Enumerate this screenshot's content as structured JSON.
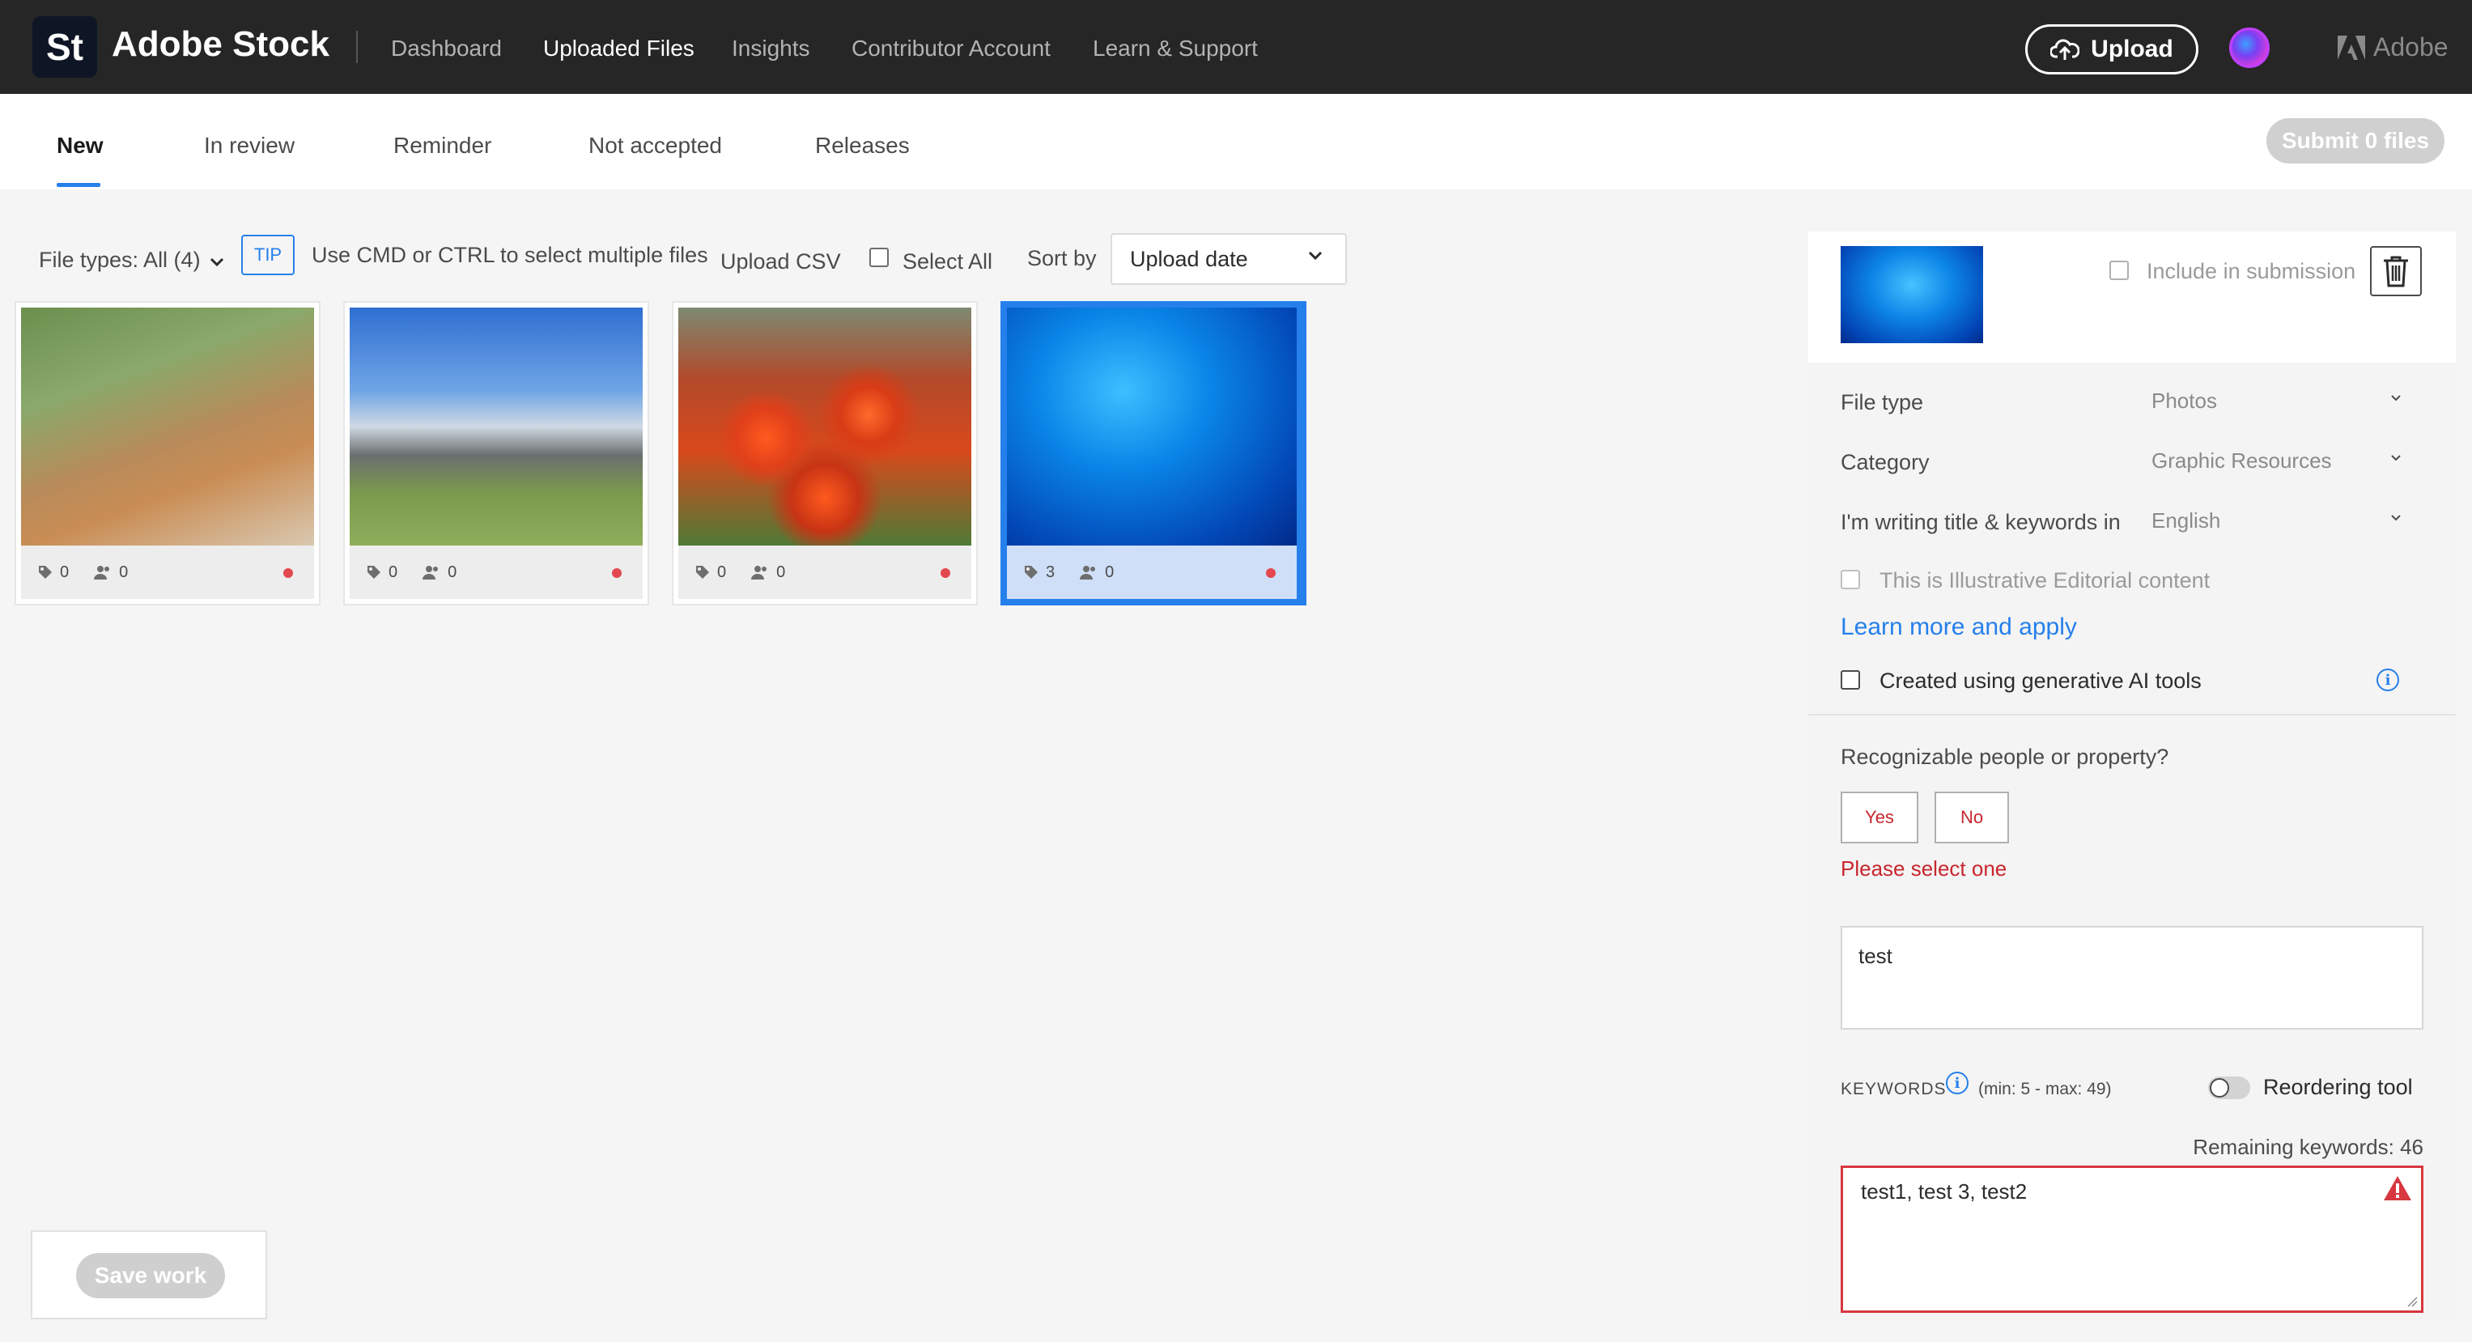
{
  "app": {
    "logo_text": "St",
    "brand": "Adobe Stock",
    "vendor": "Adobe"
  },
  "topnav": [
    "Dashboard",
    "Uploaded Files",
    "Insights",
    "Contributor Account",
    "Learn & Support"
  ],
  "topnav_active": "Uploaded Files",
  "upload_label": "Upload",
  "tabs": [
    "New",
    "In review",
    "Reminder",
    "Not accepted",
    "Releases"
  ],
  "tabs_active": "New",
  "submit_label": "Submit 0 files",
  "filter": {
    "file_types": "File types: All (4)",
    "tip": "TIP",
    "tip_text": "Use CMD or CTRL to select multiple files",
    "upload_csv": "Upload CSV",
    "select_all": "Select All",
    "sort_by": "Sort by",
    "sort_value": "Upload date"
  },
  "thumbnails": [
    {
      "keywords": "0",
      "releases": "0",
      "selected": false
    },
    {
      "keywords": "0",
      "releases": "0",
      "selected": false
    },
    {
      "keywords": "0",
      "releases": "0",
      "selected": false
    },
    {
      "keywords": "3",
      "releases": "0",
      "selected": true
    }
  ],
  "save_label": "Save work",
  "panel": {
    "include_label": "Include in submission",
    "file_type_label": "File type",
    "file_type_value": "Photos",
    "category_label": "Category",
    "category_value": "Graphic Resources",
    "language_label": "I'm writing title & keywords in",
    "language_value": "English",
    "editorial_label": "This is Illustrative Editorial content",
    "learn_more": "Learn more and apply",
    "ai_label": "Created using generative AI tools",
    "people_question": "Recognizable people or property?",
    "yes": "Yes",
    "no": "No",
    "error": "Please select one",
    "title_value": "test",
    "keywords_label": "KEYWORDS",
    "keywords_hint": "(min: 5 - max: 49)",
    "reorder_label": "Reordering tool",
    "remaining": "Remaining keywords: 46",
    "keywords_value": "test1, test 3, test2"
  },
  "colors": {
    "accent": "#2680eb",
    "error": "#d7373f",
    "topbar": "#262626"
  }
}
